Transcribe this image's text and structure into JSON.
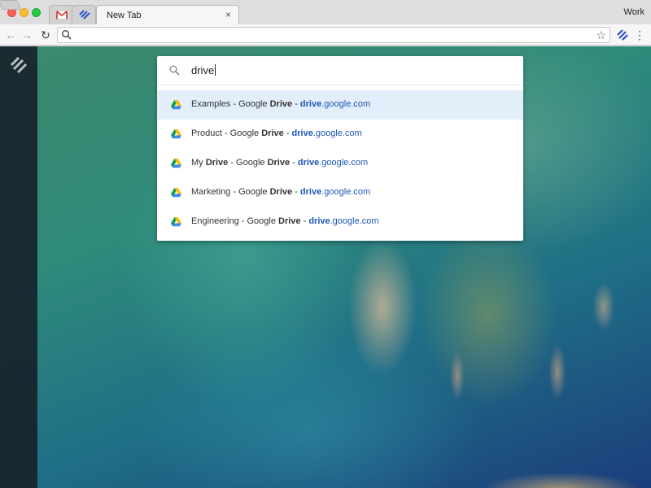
{
  "window": {
    "profile_name": "Work"
  },
  "tabs": [
    {
      "icon": "gmail-icon",
      "pinned": true
    },
    {
      "icon": "extension-logo-icon",
      "pinned": true
    },
    {
      "title": "New Tab",
      "close": "×",
      "active": true
    }
  ],
  "toolbar": {
    "back": "←",
    "forward": "→",
    "reload": "↻",
    "omnibox_value": "",
    "star": "☆",
    "menu": "⋮"
  },
  "search": {
    "query": "drive",
    "suggestions": [
      {
        "pre": "Examples - Google ",
        "bold": "Drive",
        "sep": " - ",
        "url_bold": "drive",
        "url_rest": ".google.com",
        "selected": true
      },
      {
        "pre": "Product - Google ",
        "bold": "Drive",
        "sep": " - ",
        "url_bold": "drive",
        "url_rest": ".google.com",
        "selected": false
      },
      {
        "pre": "My ",
        "bold": "Drive",
        "mid": " - Google ",
        "bold2": "Drive",
        "sep": " - ",
        "url_bold": "drive",
        "url_rest": ".google.com",
        "selected": false
      },
      {
        "pre": "Marketing - Google ",
        "bold": "Drive",
        "sep": " - ",
        "url_bold": "drive",
        "url_rest": ".google.com",
        "selected": false
      },
      {
        "pre": "Engineering - Google ",
        "bold": "Drive",
        "sep": " - ",
        "url_bold": "drive",
        "url_rest": ".google.com",
        "selected": false
      }
    ]
  },
  "colors": {
    "accent_blue": "#1d57b5",
    "selected_row": "#e3eefb"
  }
}
